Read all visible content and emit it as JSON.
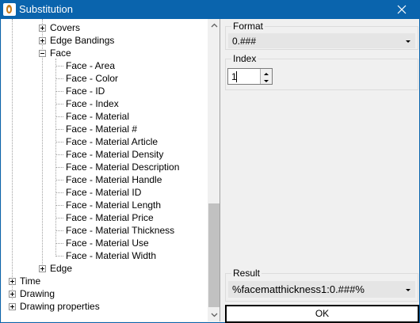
{
  "window": {
    "title": "Substitution",
    "accent_color": "#0a64ad",
    "icon": "app-logo-icon",
    "close_icon": "close-icon"
  },
  "tree": {
    "items": [
      {
        "label": "Covers",
        "expander": "plus"
      },
      {
        "label": "Edge Bandings",
        "expander": "plus"
      },
      {
        "label": "Face",
        "expander": "minus"
      },
      {
        "label": "Face - Area"
      },
      {
        "label": "Face - Color"
      },
      {
        "label": "Face - ID"
      },
      {
        "label": "Face - Index"
      },
      {
        "label": "Face - Material"
      },
      {
        "label": "Face - Material #"
      },
      {
        "label": "Face - Material Article"
      },
      {
        "label": "Face - Material Density"
      },
      {
        "label": "Face - Material Description"
      },
      {
        "label": "Face - Material Handle"
      },
      {
        "label": "Face - Material ID"
      },
      {
        "label": "Face - Material Length"
      },
      {
        "label": "Face - Material Price"
      },
      {
        "label": "Face - Material Thickness"
      },
      {
        "label": "Face - Material Use"
      },
      {
        "label": "Face - Material Width"
      },
      {
        "label": "Edge",
        "expander": "plus"
      },
      {
        "label": "Time",
        "expander": "plus"
      },
      {
        "label": "Drawing",
        "expander": "plus"
      },
      {
        "label": "Drawing properties",
        "expander": "plus"
      }
    ]
  },
  "format": {
    "label": "Format",
    "value": "0.###"
  },
  "index": {
    "label": "Index",
    "value": "1"
  },
  "result": {
    "label": "Result",
    "value": "%facematthickness1:0.###%"
  },
  "ok_label": "OK"
}
